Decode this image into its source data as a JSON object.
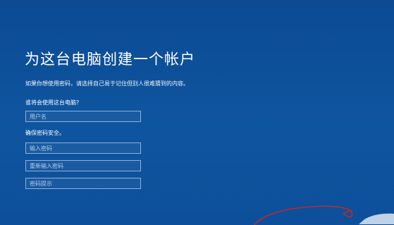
{
  "page": {
    "title": "为这台电脑创建一个帐户",
    "description": "如果你想使用密码，请选择自己易于记住但别人很难猜到的内容。",
    "question": "谁将会使用这台电脑?",
    "security_label": "确保密码安全。"
  },
  "fields": {
    "username_placeholder": "用户名",
    "password_placeholder": "输入密码",
    "reenter_placeholder": "重新输入密码",
    "hint_placeholder": "密码提示"
  },
  "colors": {
    "background": "#0d4f9a",
    "text": "#ffffff",
    "field_border": "#8fb1d8",
    "annotation": "#c0282d"
  }
}
